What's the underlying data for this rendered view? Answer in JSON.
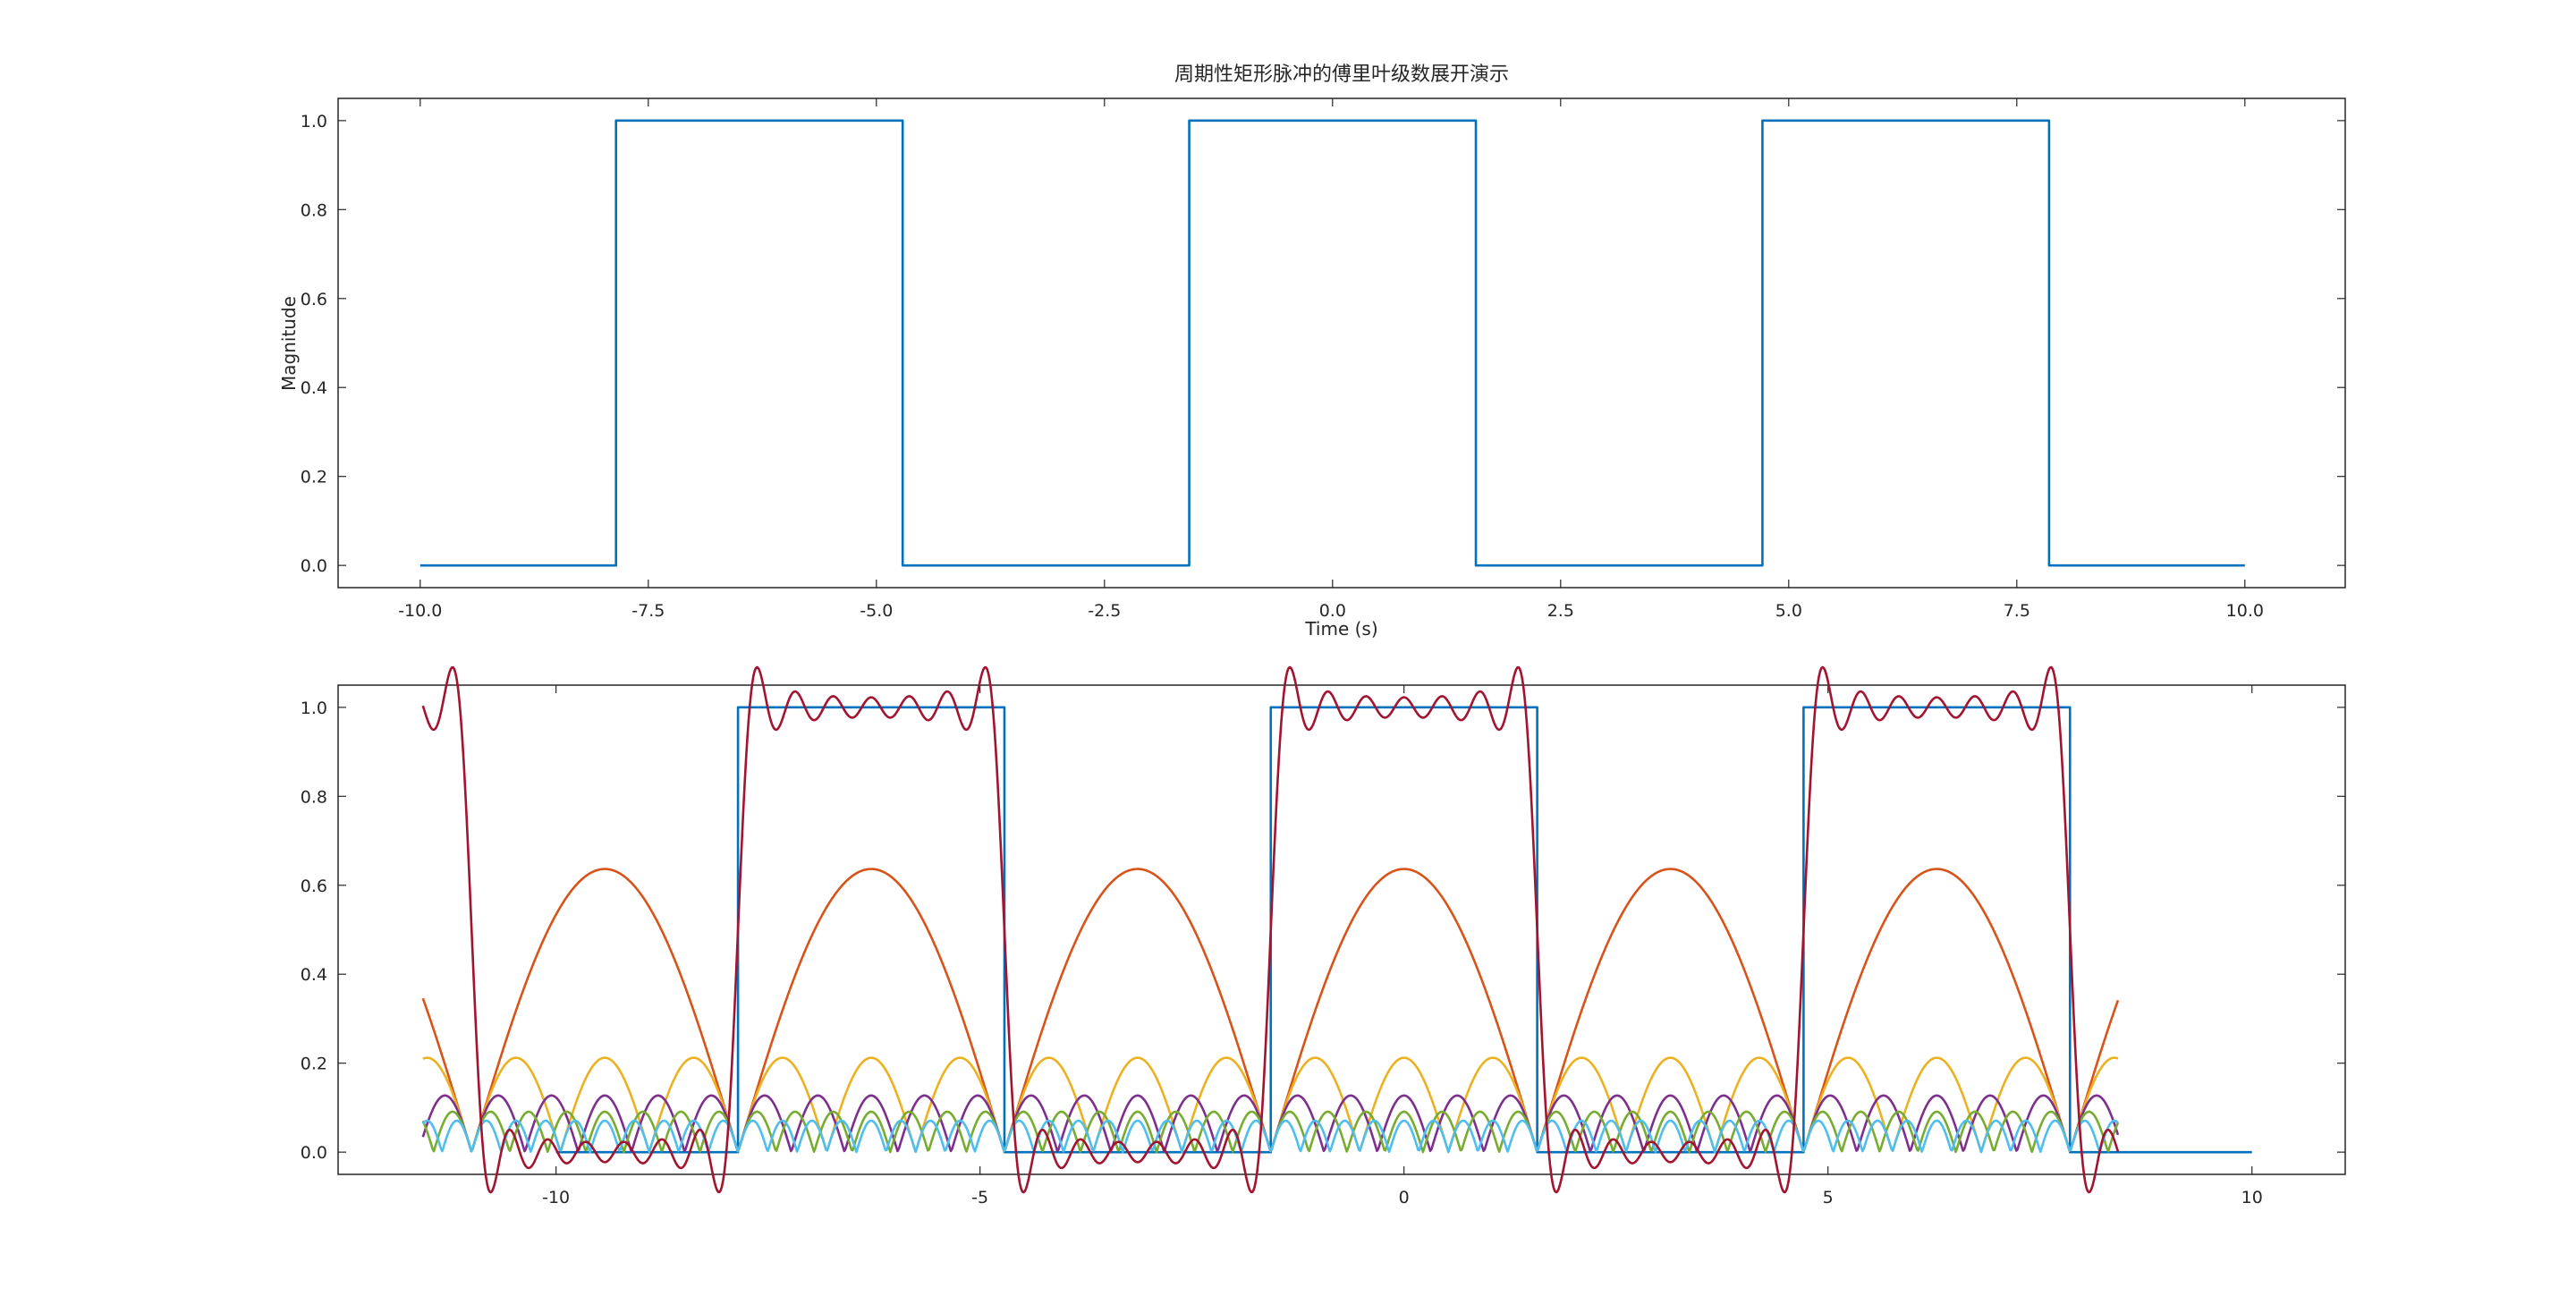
{
  "chart_data": [
    {
      "type": "line",
      "title": "周期性矩形脉冲的傅里叶级数展开演示",
      "xlabel": "Time (s)",
      "ylabel": "Magnitude",
      "xlim": [
        -10.9,
        11.1
      ],
      "ylim": [
        -0.05,
        1.05
      ],
      "xticks": [
        -10.0,
        -7.5,
        -5.0,
        -2.5,
        0.0,
        2.5,
        5.0,
        7.5,
        10.0
      ],
      "xtick_labels": [
        "-10.0",
        "-7.5",
        "-5.0",
        "-2.5",
        "0.0",
        "2.5",
        "5.0",
        "7.5",
        "10.0"
      ],
      "yticks": [
        0.0,
        0.2,
        0.4,
        0.6,
        0.8,
        1.0
      ],
      "ytick_labels": [
        "0.0",
        "0.2",
        "0.4",
        "0.6",
        "0.8",
        "1.0"
      ],
      "grid": false,
      "series": [
        {
          "color": "#0072BD",
          "x": [
            -10.0,
            -7.854,
            -7.854,
            -4.712,
            -4.712,
            -1.571,
            -1.571,
            1.571,
            1.571,
            4.712,
            4.712,
            7.854,
            7.854,
            10.0
          ],
          "y": [
            0,
            0,
            1,
            1,
            0,
            0,
            1,
            1,
            0,
            0,
            1,
            1,
            0,
            0
          ]
        }
      ]
    },
    {
      "type": "line",
      "title": "",
      "xlabel": "",
      "ylabel": "",
      "xlim": [
        -12.57,
        11.1
      ],
      "ylim": [
        -0.05,
        1.05
      ],
      "xticks": [
        -10,
        -5,
        0,
        5,
        10
      ],
      "xtick_labels": [
        "-10",
        "-5",
        "0",
        "5",
        "10"
      ],
      "yticks": [
        0.0,
        0.2,
        0.4,
        0.6,
        0.8,
        1.0
      ],
      "ytick_labels": [
        "0.0",
        "0.2",
        "0.4",
        "0.6",
        "0.8",
        "1.0"
      ],
      "grid": false,
      "period": 6.2832,
      "pulse_width": 3.1416,
      "series": [
        {
          "color": "#0072BD",
          "x": [
            -10.0,
            -7.854,
            -7.854,
            -4.712,
            -4.712,
            -1.571,
            -1.571,
            1.571,
            1.571,
            4.712,
            4.712,
            7.854,
            7.854,
            10.0
          ],
          "y": [
            0,
            0,
            1,
            1,
            0,
            0,
            1,
            1,
            0,
            0,
            1,
            1,
            0,
            0
          ]
        },
        {
          "color": "#D95319",
          "harmonic": 1,
          "amplitude": 0.6366,
          "x_range": [
            -11.57,
            8.42
          ]
        },
        {
          "color": "#EDB120",
          "harmonic": 3,
          "amplitude": 0.2122,
          "x_range": [
            -11.57,
            8.42
          ]
        },
        {
          "color": "#7E2F8E",
          "harmonic": 5,
          "amplitude": 0.1273,
          "x_range": [
            -11.57,
            8.42
          ]
        },
        {
          "color": "#77AC30",
          "harmonic": 7,
          "amplitude": 0.0909,
          "x_range": [
            -11.57,
            8.42
          ]
        },
        {
          "color": "#4DBEEE",
          "harmonic": 9,
          "amplitude": 0.0707,
          "x_range": [
            -11.57,
            8.42
          ]
        },
        {
          "color": "#A2142F",
          "harmonics": [
            1,
            3,
            5,
            7,
            9,
            11,
            13
          ],
          "offset": 0.5,
          "x_range": [
            -11.57,
            8.42
          ]
        }
      ]
    }
  ]
}
